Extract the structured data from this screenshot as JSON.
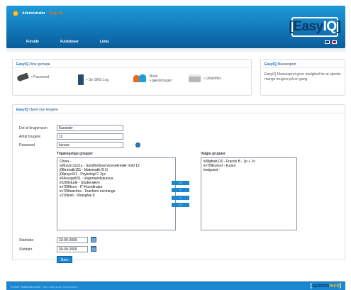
{
  "header": {
    "user_name": "Administrator",
    "logout_label": "(Log ud)",
    "nav": [
      "Forside",
      "Funktioner",
      "Links"
    ],
    "logo_easy": "Easy",
    "logo_iq": "IQ",
    "logo_open": "[",
    "logo_close": "]"
  },
  "shortcuts": {
    "title_brand": "EasyIQ",
    "title_rest": "Dine genveje",
    "items": [
      "• Password",
      "• Se SMS Log",
      "Book",
      "• gæstebruger",
      "• Udskrifter"
    ]
  },
  "mass": {
    "title_brand": "EasyIQ",
    "title_rest": "Masseopret",
    "text": "EasyIQ Masseopret giver mulighed for at oprette mange brugere på en gang."
  },
  "create_users": {
    "title_brand": "EasyIQ",
    "title_rest": "Opret nye brugere",
    "labels": {
      "username_part": "Del af brugernavn",
      "count": "Antal brugere",
      "password": "Password",
      "startdate": "Startdato",
      "enddate": "Slutdato"
    },
    "values": {
      "username_part": "Kursister",
      "count": "12",
      "password": "kursus",
      "startdate": "23-09-2009",
      "enddate": "30-09-2009"
    },
    "available_heading": "Tilgængelige grupper",
    "selected_heading": "Valgte grupper",
    "available_groups": [
      "China -",
      "a06sus12u11u - Sundhedsservicesekretær hold 12",
      "j08mmatb161 - Matematik B 2i",
      "j09psyc311 - Psykologi C 3yz",
      "k04vvoga531 - Vognmandskursus",
      "kv209stude - Studienævn",
      "kv709fkoor - IT-Koordinator",
      "kv709teaches - Teachers exchange",
      "v110testi - Shanghai 9"
    ],
    "selected_groups": [
      "k08gfrab110 - Fransk B - 1p + 1v",
      "kv709kursor - kursor",
      "testguest -"
    ],
    "move_buttons": [
      ">>",
      ">",
      "<",
      "<<"
    ],
    "submit_label": "Gem"
  },
  "footer": {
    "copyright": "© 2007 Systemtech A/S",
    "links": "Alle rettigheder forbeholdes",
    "brand_system": "system",
    "brand_tech": "tech"
  },
  "colors": {
    "header_blue": "#1b87d0",
    "brand_dark": "#0b3a66",
    "logout_orange": "#ff6a00",
    "accent_yellow": "#f5b41a"
  }
}
